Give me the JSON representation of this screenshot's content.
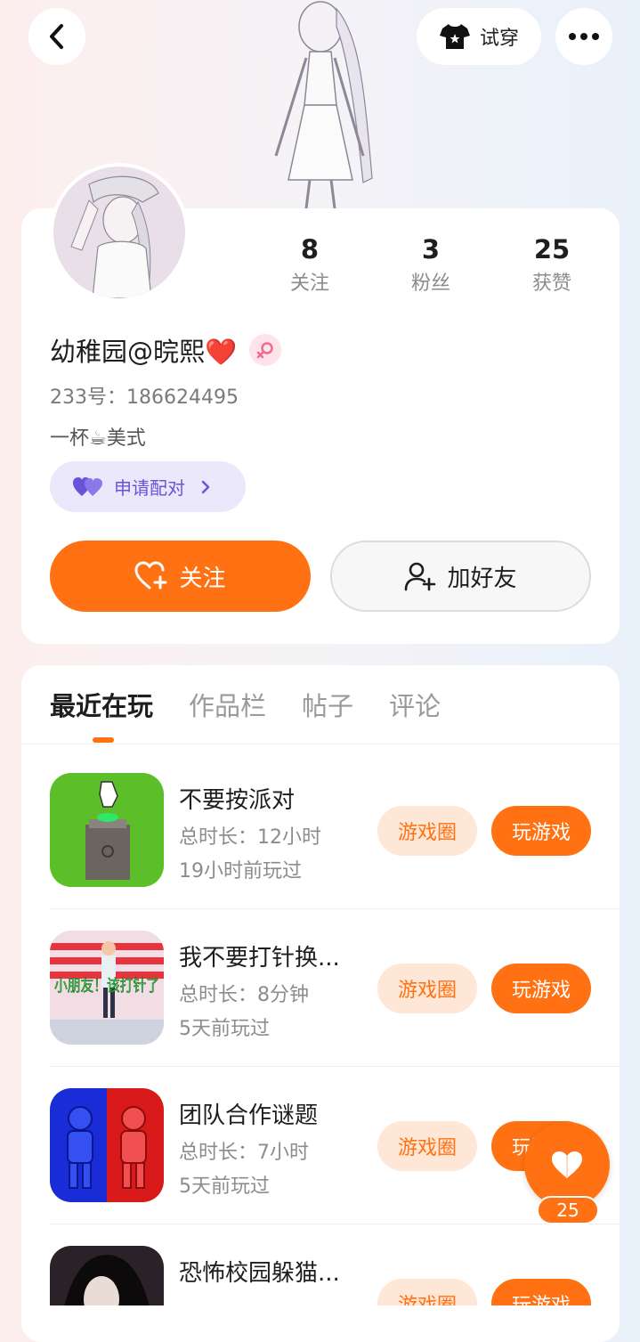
{
  "header": {
    "tryon_label": "试穿"
  },
  "profile": {
    "name": "幼稚园@晥熙❤️",
    "uid": "233号：186624495",
    "bio": "一杯☕美式",
    "pair_label": "申请配对",
    "stats": [
      {
        "value": "8",
        "label": "关注"
      },
      {
        "value": "3",
        "label": "粉丝"
      },
      {
        "value": "25",
        "label": "获赞"
      }
    ],
    "follow_label": "关注",
    "add_friend_label": "加好友"
  },
  "tabs": [
    {
      "label": "最近在玩",
      "active": true
    },
    {
      "label": "作品栏",
      "active": false
    },
    {
      "label": "帖子",
      "active": false
    },
    {
      "label": "评论",
      "active": false
    }
  ],
  "games": [
    {
      "title": "不要按派对",
      "duration": "总时长：12小时",
      "last_played": "19小时前玩过",
      "circle_label": "游戏圈",
      "play_label": "玩游戏"
    },
    {
      "title": "我不要打针换...",
      "duration": "总时长：8分钟",
      "last_played": "5天前玩过",
      "circle_label": "游戏圈",
      "play_label": "玩游戏",
      "icon_text": "小朋友！该打针了"
    },
    {
      "title": "团队合作谜题",
      "duration": "总时长：7小时",
      "last_played": "5天前玩过",
      "circle_label": "游戏圈",
      "play_label": "玩游戏"
    },
    {
      "title": "恐怖校园躲猫...",
      "duration": "",
      "last_played": "",
      "circle_label": "游戏圈",
      "play_label": "玩游戏"
    }
  ],
  "floating_like": {
    "count": "25"
  },
  "colors": {
    "accent": "#ff7112",
    "accent_light": "#ffe7d7",
    "pair_purple": "#6a53d9"
  }
}
